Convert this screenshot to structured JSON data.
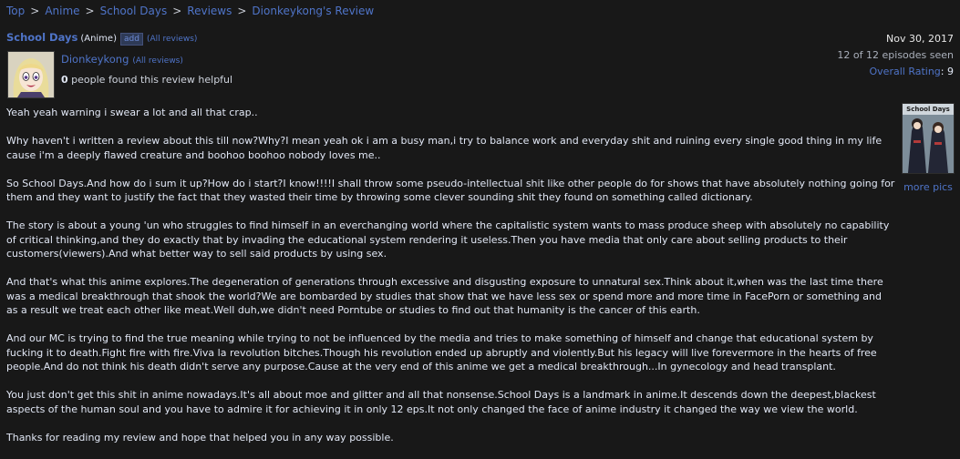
{
  "breadcrumb": [
    {
      "label": "Top"
    },
    {
      "label": "Anime"
    },
    {
      "label": "School Days"
    },
    {
      "label": "Reviews"
    },
    {
      "label": "Dionkeykong's Review"
    }
  ],
  "breadcrumb_separator": ">",
  "anime": {
    "title": "School Days",
    "type": "(Anime)",
    "add_label": "add",
    "all_reviews_label": "(All reviews)"
  },
  "reviewer": {
    "name": "Dionkeykong",
    "all_reviews_label": "(All reviews)",
    "helpful_count": "0",
    "helpful_text": "people found this review helpful"
  },
  "meta": {
    "date": "Nov 30, 2017",
    "episodes_seen": "12 of 12 episodes seen",
    "rating_label": "Overall Rating",
    "rating_value": "9"
  },
  "sidebar": {
    "thumb_title": "School Days",
    "more_pics_label": "more pics"
  },
  "review": {
    "paragraphs": [
      "Yeah yeah warning i swear a lot and all that crap..",
      "Why haven't i written a review about this till now?Why?I mean yeah ok i am a busy man,i try to balance work and everyday shit and ruining every single good thing in my life cause i'm a deeply flawed creature and boohoo boohoo nobody loves me..",
      "So School Days.And how do i sum it up?How do i start?I know!!!!I shall throw some pseudo-intellectual shit like other people do for shows that have absolutely nothing going for them and they want to justify the fact that they wasted their time by throwing some clever sounding shit they found on something called dictionary.",
      "The story is about a young 'un who struggles to find himself in an everchanging world where the capitalistic system wants to mass produce sheep with absolutely no capability of critical thinking,and they do exactly that by invading the educational system rendering it useless.Then you have media that only care about selling products to their customers(viewers).And what better way to sell said products by using sex.",
      "And that's what this anime explores.The degeneration of generations through excessive and disgusting exposure to unnatural sex.Think about it,when was the last time there was a medical breakthrough that shook the world?We are bombarded by studies that show that we have less sex or spend more and more time in FacePorn or something and as a result we treat each other like meat.Well duh,we didn't need Porntube or studies to find out that humanity is the cancer of this earth.",
      "And our MC is trying to find the true meaning while trying to not be influenced by the media and tries to make something of himself and change that educational system by fucking it to death.Fight fire with fire.Viva la revolution bitches.Though his revolution ended up abruptly and violently.But his legacy will live forevermore in the hearts of free people.And do not think his death didn't serve any purpose.Cause at the very end of this anime we get a medical breakthrough...In gynecology and head transplant.",
      "You just don't get this shit in anime nowadays.It's all about moe and glitter and all that nonsense.School Days is a landmark in anime.It descends down the deepest,blackest aspects of the human soul and you have to admire it for achieving it in only 12 eps.It not only changed the face of anime industry it changed the way we view the world.",
      "Thanks for reading my review and hope that helped you in any way possible."
    ]
  }
}
